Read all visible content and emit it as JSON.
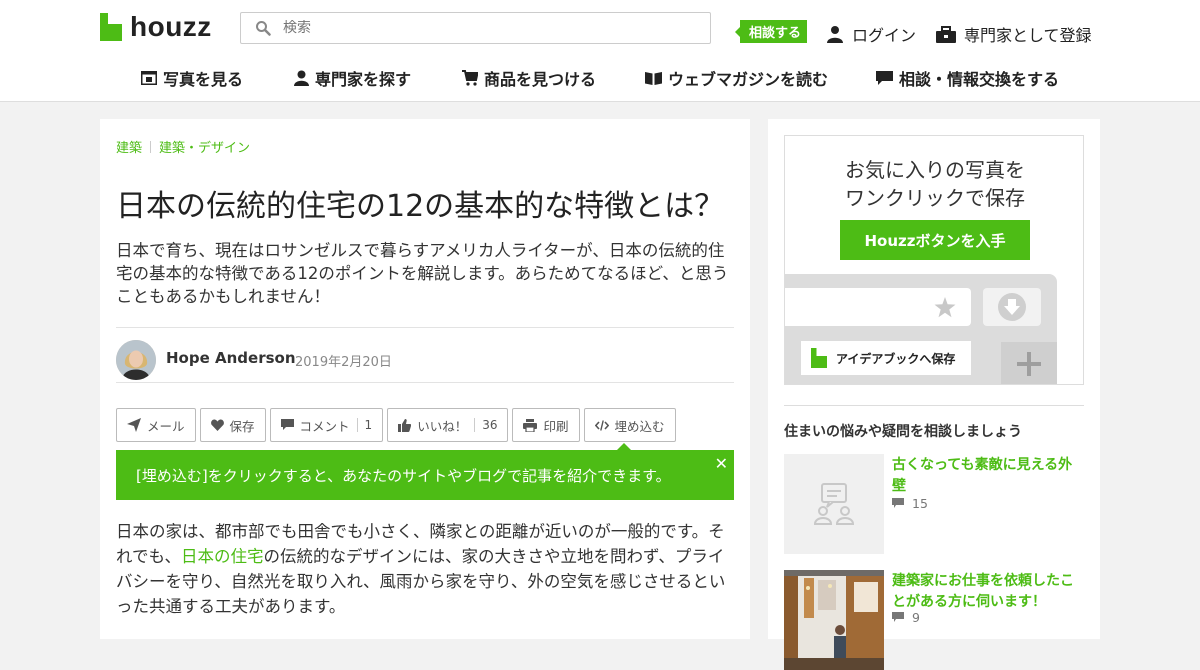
{
  "header": {
    "logo_text": "houzz",
    "search_placeholder": "検索",
    "consult_label": "相談する",
    "login_label": "ログイン",
    "register_label": "専門家として登録"
  },
  "nav": {
    "items": [
      {
        "label": "写真を見る",
        "icon": "photo-icon"
      },
      {
        "label": "専門家を探す",
        "icon": "person-icon"
      },
      {
        "label": "商品を見つける",
        "icon": "cart-icon"
      },
      {
        "label": "ウェブマガジンを読む",
        "icon": "book-icon"
      },
      {
        "label": "相談・情報交換をする",
        "icon": "chat-icon"
      }
    ]
  },
  "article": {
    "breadcrumb": [
      "建築",
      "建築・デザイン"
    ],
    "title": "日本の伝統的住宅の12の基本的な特徴とは？",
    "subtitle": "日本で育ち、現在はロサンゼルスで暮らすアメリカ人ライターが、日本の伝統的住宅の基本的な特徴である12のポイントを解説します。あらためてなるほど、と思うこともあるかもしれません！",
    "author": "Hope Anderson",
    "date": "2019年2月20日",
    "actions": {
      "mail": "メール",
      "save": "保存",
      "comment": "コメント",
      "comment_count": "1",
      "like": "いいね！",
      "like_count": "36",
      "print": "印刷",
      "embed": "埋め込む"
    },
    "embed_banner": "[埋め込む]をクリックすると、あなたのサイトやブログで記事を紹介できます。",
    "body_before_link": "日本の家は、都市部でも田舎でも小さく、隣家との距離が近いのが一般的です。それでも、",
    "body_link": "日本の住宅",
    "body_after_link": "の伝統的なデザインには、家の大きさや立地を問わず、プライバシーを守り、自然光を取り入れ、風雨から家を守り、外の空気を感じさせるといった共通する工夫があります。"
  },
  "sidebar": {
    "promo": {
      "title_line1": "お気に入りの写真を",
      "title_line2": "ワンクリックで保存",
      "button": "Houzzボタンを入手",
      "popup_label": "アイデアブックへ保存"
    },
    "questions_heading": "住まいの悩みや疑問を相談しましょう",
    "questions": [
      {
        "title": "古くなっても素敵に見える外壁",
        "count": "15"
      },
      {
        "title": "建築家にお仕事を依頼したことがある方に伺います！",
        "count": "9"
      }
    ]
  },
  "colors": {
    "brand_green": "#4dbc15",
    "text_dark": "#222222"
  }
}
